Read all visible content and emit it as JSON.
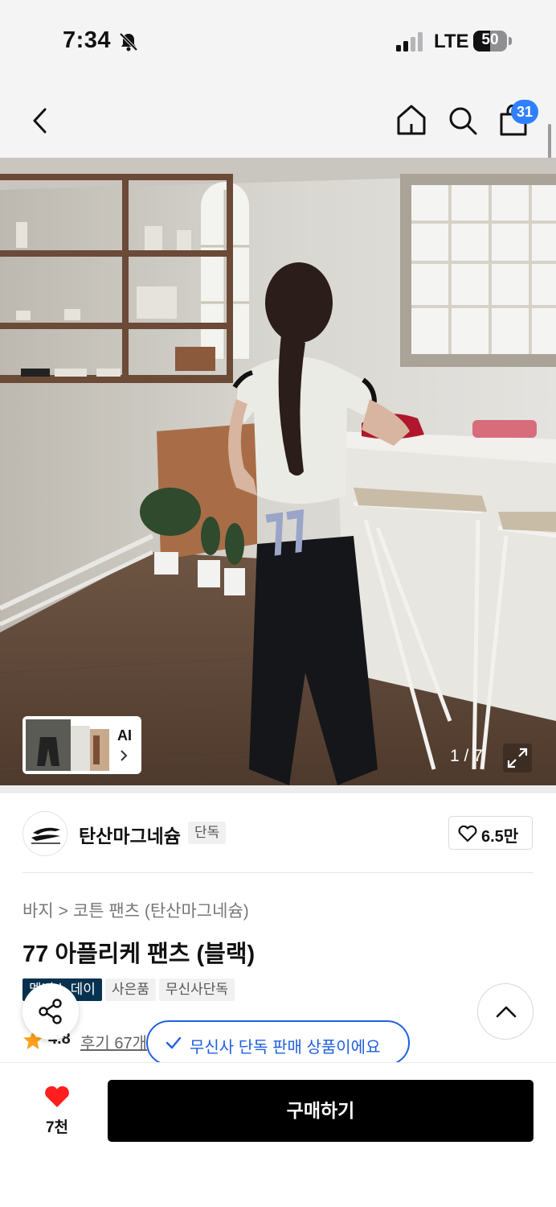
{
  "status_bar": {
    "time": "7:34",
    "network": "LTE",
    "battery": "50",
    "battery_level": 0.5
  },
  "nav": {
    "cart_count": "31"
  },
  "gallery": {
    "ai_label": "AI",
    "counter": "1 / 7"
  },
  "brand": {
    "name": "탄산마그네슘",
    "badge": "단독",
    "like_count": "6.5만"
  },
  "breadcrumb": {
    "category": "바지",
    "separator": ">",
    "subcategory": "코튼 팬츠 (탄산마그네슘)"
  },
  "product": {
    "title": "77 아플리케 팬츠 (블랙)"
  },
  "tags": [
    "멤버스 데이",
    "사은품",
    "무신사단독"
  ],
  "rating": {
    "value": "4.8",
    "reviews": "후기 67개"
  },
  "exclusive_notice": "무신사 단독 판매 상품이에요",
  "bottom": {
    "wish_count": "7천",
    "buy_label": "구매하기"
  },
  "colors": {
    "accent_blue": "#1f5fe0",
    "badge_blue": "#2f80ff",
    "tag_navy": "#06324f",
    "heart_red": "#ff1f1f",
    "star": "#ff9f1a"
  }
}
